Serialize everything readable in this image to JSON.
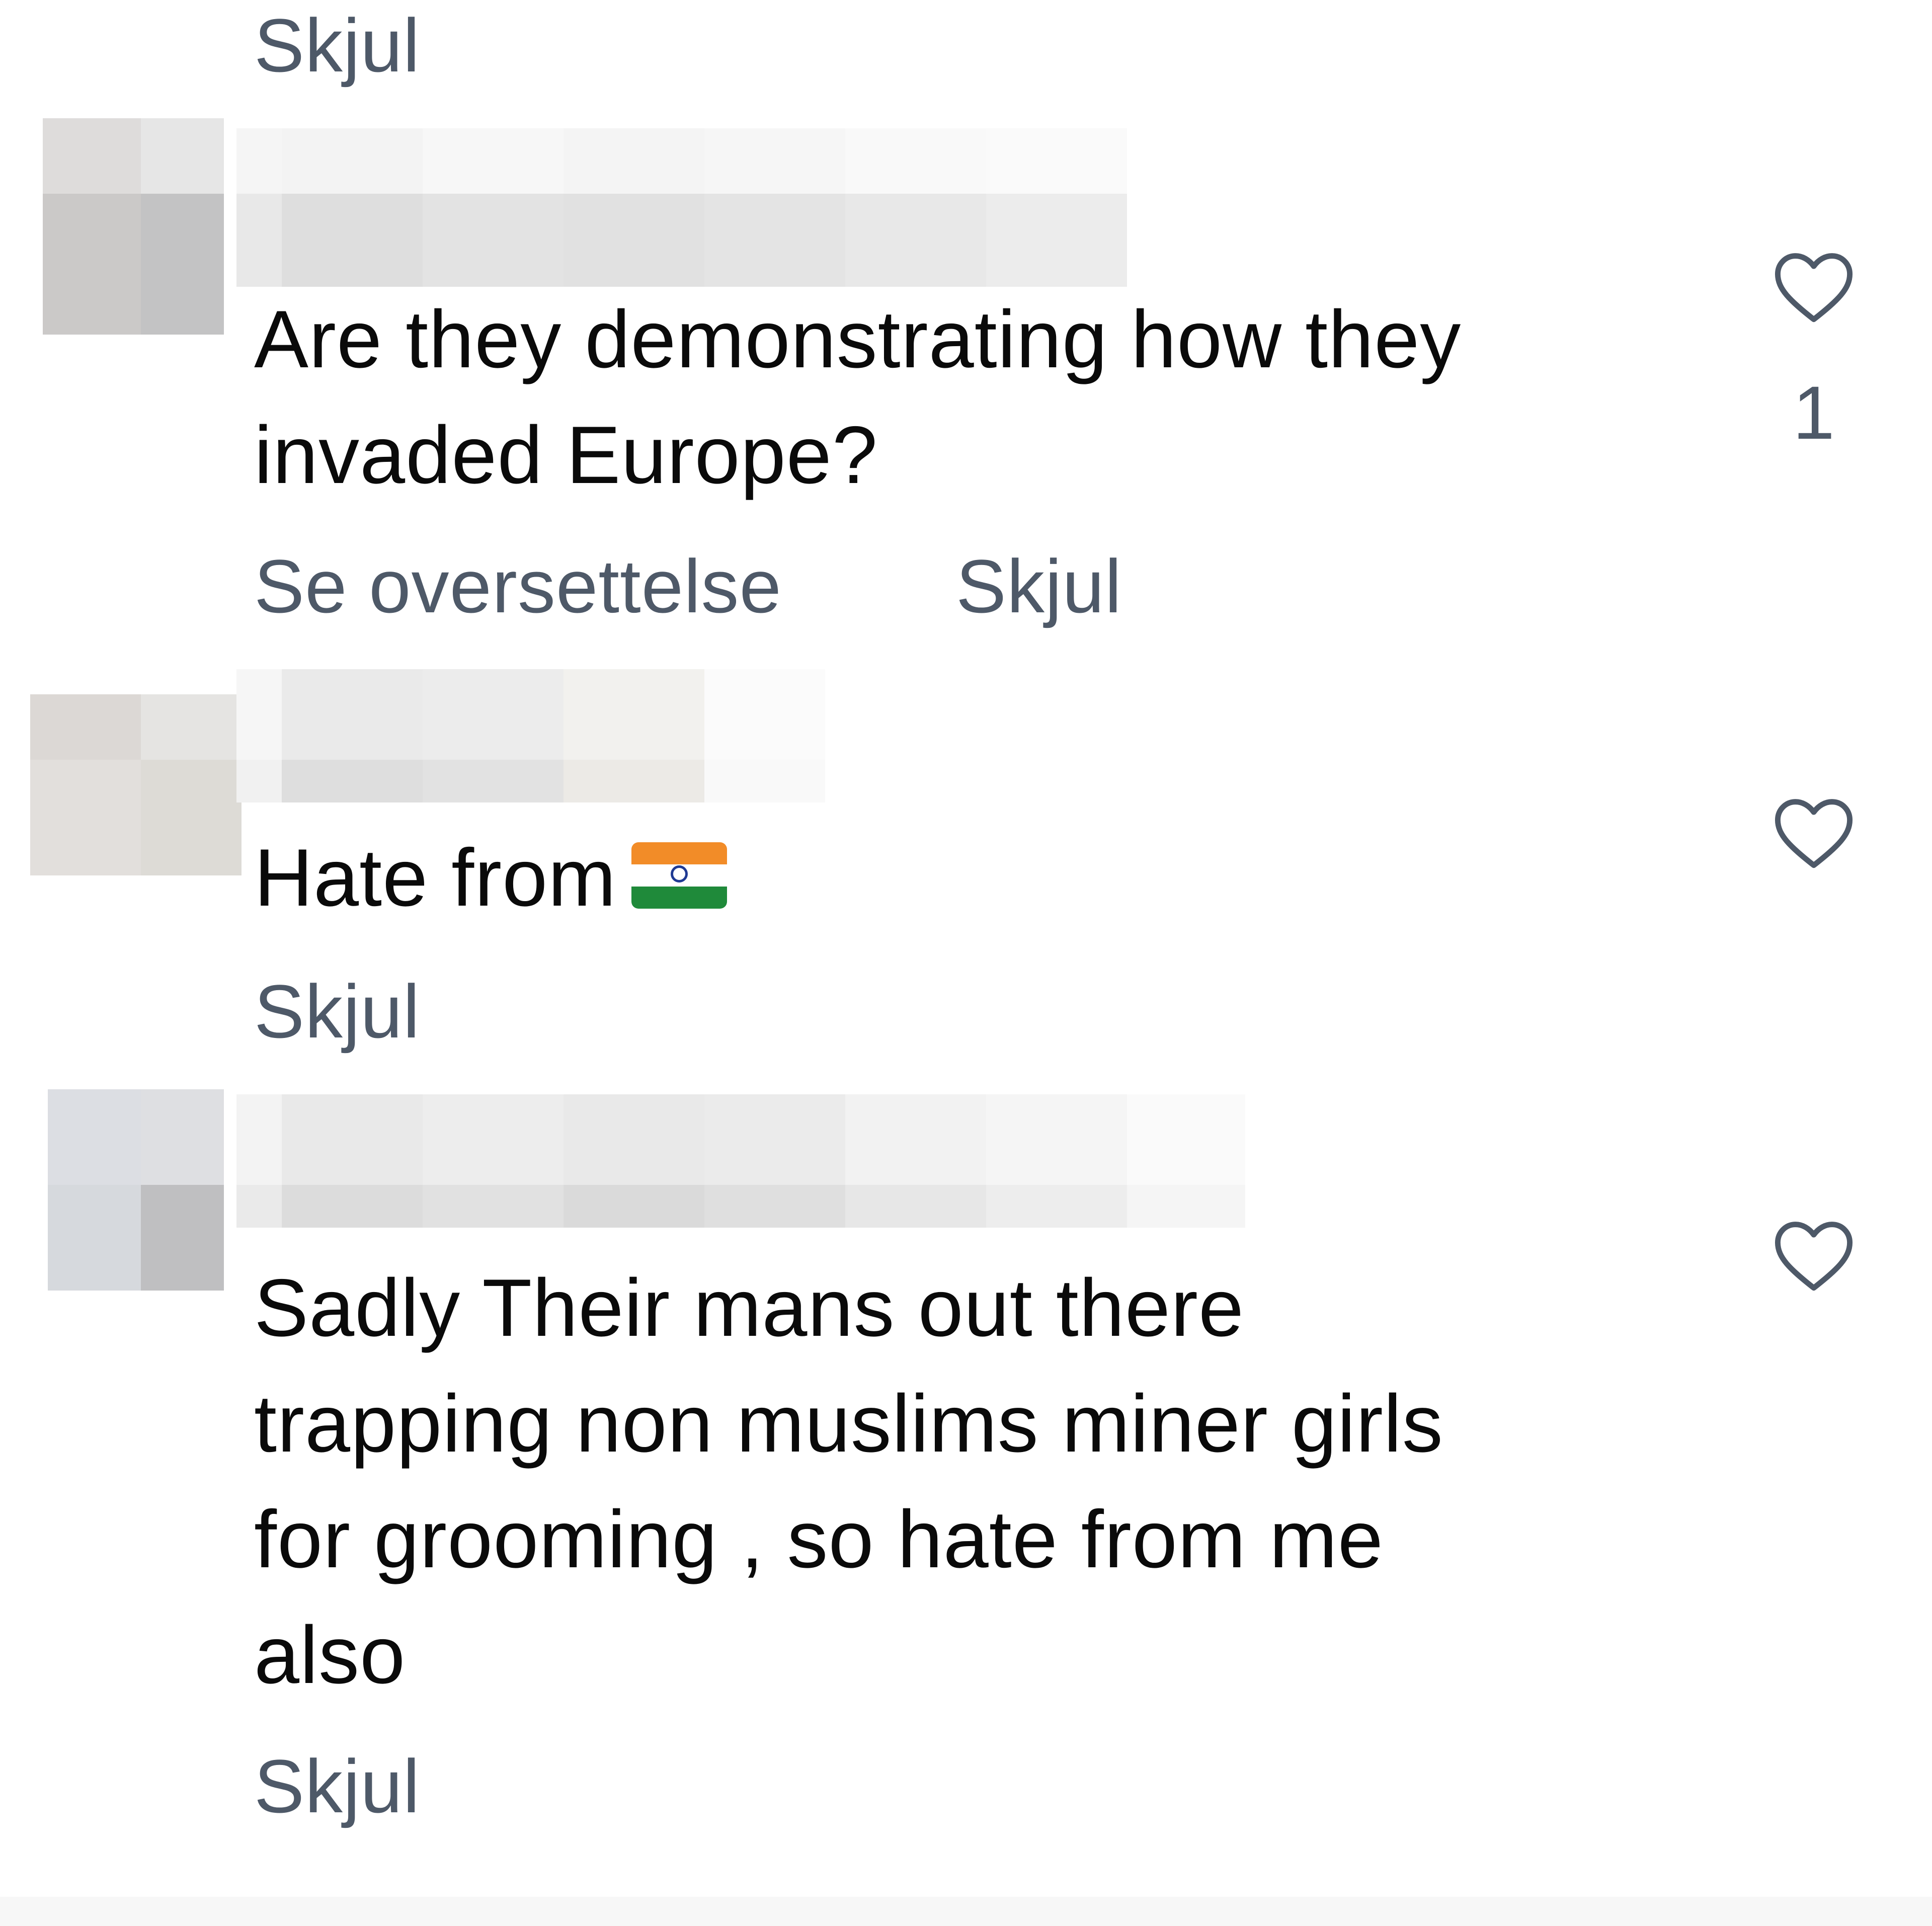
{
  "top": {
    "hide_label": "Skjul"
  },
  "comments": [
    {
      "lines": [
        "Are they demonstrating how they",
        "invaded Europe?"
      ],
      "translate_label": "Se oversettelse",
      "hide_label": "Skjul",
      "like_count": "1"
    },
    {
      "text": "Hate from",
      "emoji": "india-flag",
      "hide_label": "Skjul"
    },
    {
      "lines": [
        "Sadly Their mans out there",
        "trapping non muslims miner girls",
        "for grooming , so hate from me",
        "also"
      ],
      "hide_label": "Skjul"
    }
  ],
  "icons": {
    "like": "heart-outline-icon"
  },
  "colors": {
    "link": "#4e5968",
    "text": "#0a0a0a",
    "background": "#ffffff",
    "flag_saffron": "#f28c28",
    "flag_white": "#ffffff",
    "flag_green": "#1f8a3a"
  }
}
